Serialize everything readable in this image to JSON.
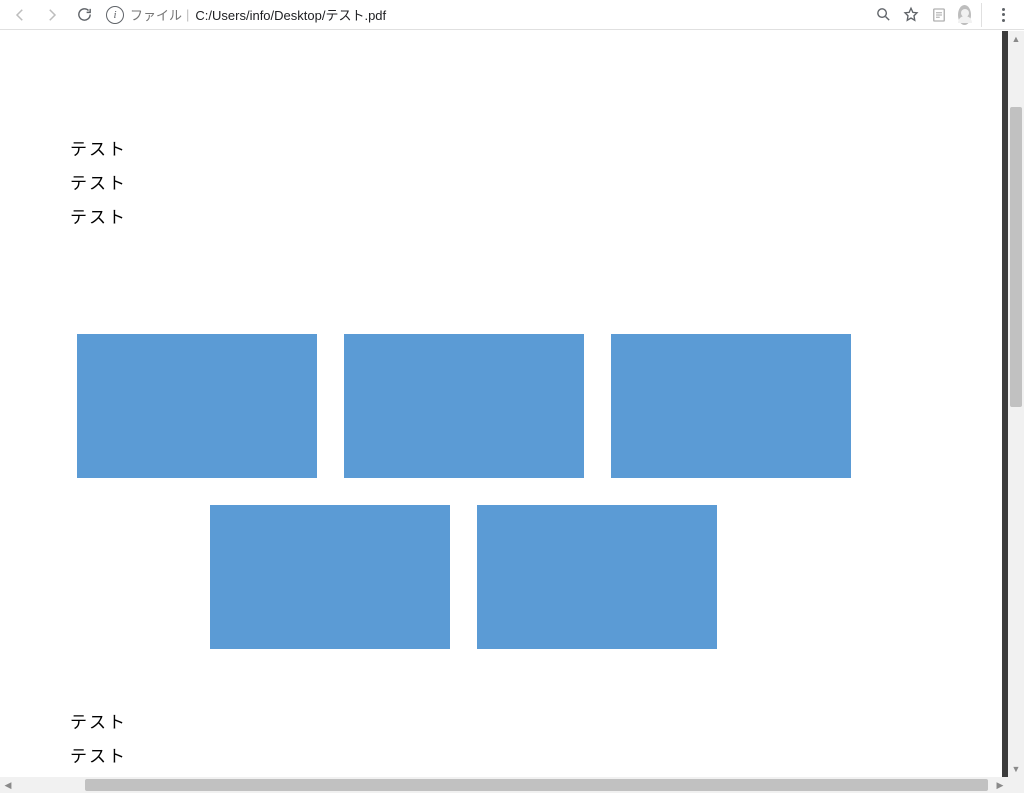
{
  "toolbar": {
    "file_label": "ファイル",
    "url": "C:/Users/info/Desktop/テスト.pdf"
  },
  "document": {
    "top_lines": [
      "テスト",
      "テスト",
      "テスト"
    ],
    "bottom_lines": [
      "テスト",
      "テスト"
    ],
    "rects": {
      "row1_count": 3,
      "row2_count": 2,
      "color": "#5b9bd5"
    }
  }
}
